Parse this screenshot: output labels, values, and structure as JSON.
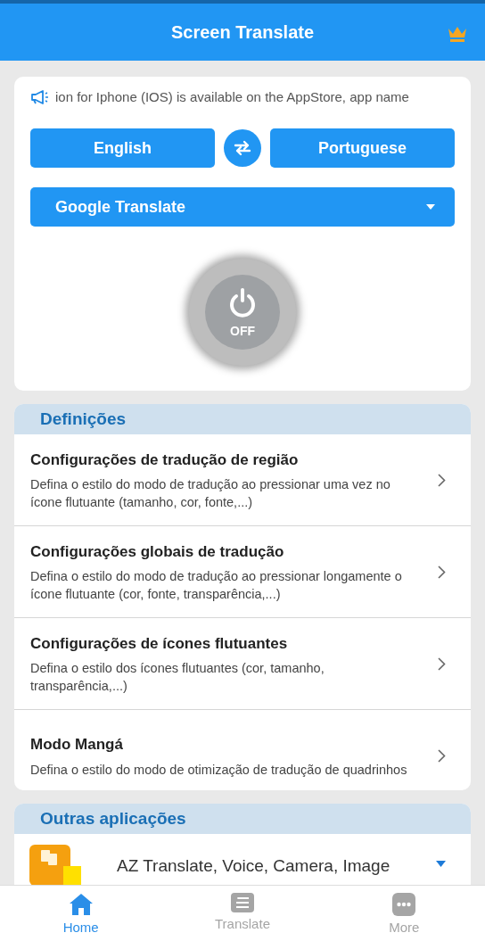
{
  "app_bar": {
    "title": "Screen Translate"
  },
  "announcement": {
    "text": "ion for Iphone (IOS) is available on the AppStore, app name"
  },
  "languages": {
    "source": "English",
    "target": "Portuguese"
  },
  "engine": {
    "value": "Google Translate"
  },
  "power": {
    "on": false,
    "label": "OFF"
  },
  "settings": {
    "title": "Definições",
    "items": [
      {
        "title": "Configurações de tradução de região",
        "description": "Defina o estilo do modo de tradução ao pressionar uma vez no ícone flutuante (tamanho, cor, fonte,...)"
      },
      {
        "title": "Configurações globais de tradução",
        "description": "Defina o estilo do modo de tradução ao pressionar longamente o ícone flutuante (cor, fonte, transparência,...)"
      },
      {
        "title": "Configurações de ícones flutuantes",
        "description": "Defina o estilo dos ícones flutuantes (cor, tamanho, transparência,...)"
      },
      {
        "title": "Modo Mangá",
        "description": "Defina o estilo do modo de otimização de tradução de quadrinhos"
      }
    ]
  },
  "other_apps": {
    "title": "Outras aplicações",
    "items": [
      {
        "name": "AZ Translate, Voice, Camera, Image"
      }
    ]
  },
  "bottom_nav": [
    {
      "label": "Home",
      "kind": "home",
      "selected": true
    },
    {
      "label": "Translate",
      "kind": "list",
      "selected": false
    },
    {
      "label": "More",
      "kind": "more",
      "selected": false
    }
  ]
}
